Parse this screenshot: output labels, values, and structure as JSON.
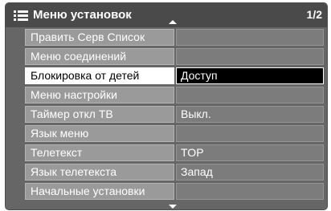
{
  "header": {
    "icon": "menu-list-icon",
    "title": "Меню установок",
    "page": "1/2"
  },
  "menu": {
    "items": [
      {
        "label": "Править Серв Список",
        "value": ""
      },
      {
        "label": "Меню соединений",
        "value": ""
      },
      {
        "label": "Блокировка от детей",
        "value": "Доступ"
      },
      {
        "label": "Меню настройки",
        "value": ""
      },
      {
        "label": "Таймер откл ТВ",
        "value": "Выкл."
      },
      {
        "label": "Язык меню",
        "value": ""
      },
      {
        "label": "Телетекст",
        "value": "TOP"
      },
      {
        "label": "Язык телетекста",
        "value": "Запад"
      },
      {
        "label": "Начальные установки",
        "value": ""
      }
    ],
    "selected_index": 2
  },
  "colors": {
    "panel": "#666666",
    "label_bg": "#9a9a9a",
    "value_bg": "#7c7c7c",
    "selected_label_bg": "#ffffff",
    "selected_value_bg": "#000000"
  }
}
